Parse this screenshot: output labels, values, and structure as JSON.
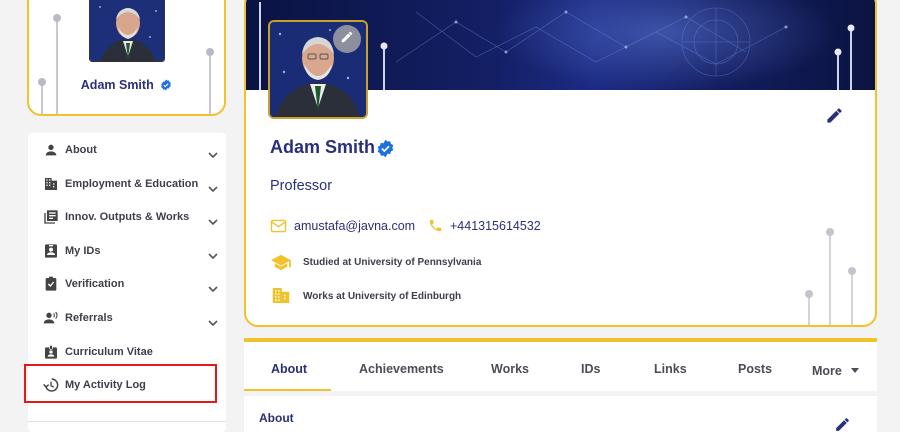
{
  "user": {
    "name": "Adam Smith",
    "title": "Professor",
    "email": "amustafa@javna.com",
    "phone": "+441315614532",
    "studied": "Studied at University of Pennsylvania",
    "works": "Works at University of Edinburgh"
  },
  "sidebar": {
    "items": [
      {
        "label": "About",
        "icon": "person-icon",
        "expandable": true
      },
      {
        "label": "Employment & Education",
        "icon": "building-icon",
        "expandable": true
      },
      {
        "label": "Innov. Outputs & Works",
        "icon": "library-icon",
        "expandable": true
      },
      {
        "label": "My IDs",
        "icon": "id-card-icon",
        "expandable": true
      },
      {
        "label": "Verification",
        "icon": "clipboard-check-icon",
        "expandable": true
      },
      {
        "label": "Referrals",
        "icon": "record-voice-icon",
        "expandable": true
      },
      {
        "label": "Curriculum Vitae",
        "icon": "badge-icon",
        "expandable": false
      },
      {
        "label": "My Activity Log",
        "icon": "history-icon",
        "expandable": false
      }
    ]
  },
  "tabs": {
    "items": [
      "About",
      "Achievements",
      "Works",
      "IDs",
      "Links",
      "Posts",
      "More"
    ],
    "active": "About"
  },
  "section": {
    "title": "About"
  },
  "colors": {
    "accent": "#f0c22b",
    "primary": "#2a2f7a",
    "verified": "#1e6fe0",
    "highlight": "#e01b1b"
  }
}
